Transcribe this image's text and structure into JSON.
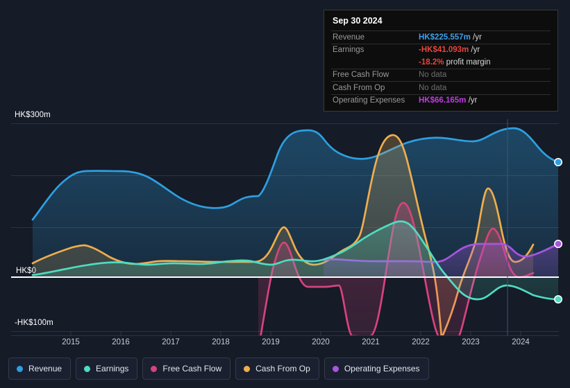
{
  "tooltip": {
    "date": "Sep 30 2024",
    "rows": [
      {
        "key": "Revenue",
        "value": "HK$225.557m",
        "unit": " /yr",
        "color": "#3f9fe8",
        "sub": false
      },
      {
        "key": "Earnings",
        "value": "-HK$41.093m",
        "unit": " /yr",
        "color": "#e8453c",
        "sub": false
      },
      {
        "key": "",
        "value": "-18.2%",
        "unit": " profit margin",
        "color": "#e8453c",
        "sub": true
      },
      {
        "key": "Free Cash Flow",
        "value": "No data",
        "unit": "",
        "color": "#6e6e6e",
        "sub": false
      },
      {
        "key": "Cash From Op",
        "value": "No data",
        "unit": "",
        "color": "#6e6e6e",
        "sub": false
      },
      {
        "key": "Operating Expenses",
        "value": "HK$66.165m",
        "unit": " /yr",
        "color": "#c13ae8",
        "sub": false
      }
    ]
  },
  "legend": [
    {
      "label": "Revenue",
      "color": "#2e9fe0"
    },
    {
      "label": "Earnings",
      "color": "#4fdcc0"
    },
    {
      "label": "Free Cash Flow",
      "color": "#d6437e"
    },
    {
      "label": "Cash From Op",
      "color": "#efae4e"
    },
    {
      "label": "Operating Expenses",
      "color": "#a855e0"
    }
  ],
  "chart_data": {
    "type": "line",
    "title": "",
    "xlabel": "",
    "ylabel": "",
    "currency": "HK$",
    "unit": "m",
    "grid": true,
    "legend_position": "bottom",
    "ylim": [
      -130,
      320
    ],
    "y_ticks": [
      {
        "value": 300,
        "label": "HK$300m"
      },
      {
        "value": 200,
        "label": ""
      },
      {
        "value": 100,
        "label": ""
      },
      {
        "value": 0,
        "label": "HK$0"
      },
      {
        "value": -100,
        "label": "-HK$100m"
      }
    ],
    "x_ticks": [
      "2015",
      "2016",
      "2017",
      "2018",
      "2019",
      "2020",
      "2021",
      "2022",
      "2023",
      "2024"
    ],
    "x_range": [
      "2014-06",
      "2024-09"
    ],
    "series": [
      {
        "name": "Revenue",
        "color": "#2e9fe0",
        "points": [
          {
            "x": "2014-06",
            "y": 83
          },
          {
            "x": "2014-12",
            "y": 128
          },
          {
            "x": "2015-03",
            "y": 152
          },
          {
            "x": "2015-06",
            "y": 153
          },
          {
            "x": "2016-03",
            "y": 152
          },
          {
            "x": "2016-09",
            "y": 143
          },
          {
            "x": "2017-03",
            "y": 132
          },
          {
            "x": "2017-09",
            "y": 126
          },
          {
            "x": "2018-03",
            "y": 122
          },
          {
            "x": "2018-09",
            "y": 125
          },
          {
            "x": "2019-03",
            "y": 178
          },
          {
            "x": "2019-09",
            "y": 248
          },
          {
            "x": "2020-03",
            "y": 234
          },
          {
            "x": "2020-09",
            "y": 219
          },
          {
            "x": "2021-03",
            "y": 212
          },
          {
            "x": "2021-09",
            "y": 229
          },
          {
            "x": "2022-03",
            "y": 238
          },
          {
            "x": "2022-09",
            "y": 233
          },
          {
            "x": "2023-03",
            "y": 231
          },
          {
            "x": "2023-09",
            "y": 254
          },
          {
            "x": "2024-03",
            "y": 243
          },
          {
            "x": "2024-09",
            "y": 225.557
          }
        ]
      },
      {
        "name": "Earnings",
        "color": "#4fdcc0",
        "points": [
          {
            "x": "2014-06",
            "y": 3
          },
          {
            "x": "2015-03",
            "y": 14
          },
          {
            "x": "2016-03",
            "y": 22
          },
          {
            "x": "2016-09",
            "y": 19
          },
          {
            "x": "2017-06",
            "y": 21
          },
          {
            "x": "2018-03",
            "y": 16
          },
          {
            "x": "2018-09",
            "y": 20
          },
          {
            "x": "2019-03",
            "y": 26
          },
          {
            "x": "2019-09",
            "y": 22
          },
          {
            "x": "2020-03",
            "y": 30
          },
          {
            "x": "2020-09",
            "y": 48
          },
          {
            "x": "2021-03",
            "y": 73
          },
          {
            "x": "2021-06",
            "y": 79
          },
          {
            "x": "2021-09",
            "y": 74
          },
          {
            "x": "2022-03",
            "y": 20
          },
          {
            "x": "2022-09",
            "y": -37
          },
          {
            "x": "2023-03",
            "y": -43
          },
          {
            "x": "2023-09",
            "y": -24
          },
          {
            "x": "2024-03",
            "y": -33
          },
          {
            "x": "2024-09",
            "y": -41.093
          }
        ]
      },
      {
        "name": "Free Cash Flow",
        "color": "#d6437e",
        "points": [
          {
            "x": "2018-09",
            "y": -106
          },
          {
            "x": "2019-03",
            "y": 22
          },
          {
            "x": "2019-09",
            "y": -34
          },
          {
            "x": "2020-03",
            "y": -32
          },
          {
            "x": "2020-06",
            "y": -115
          },
          {
            "x": "2021-03",
            "y": 105
          },
          {
            "x": "2021-09",
            "y": -30
          },
          {
            "x": "2022-03",
            "y": -122
          },
          {
            "x": "2022-09",
            "y": -14
          },
          {
            "x": "2023-03",
            "y": 70
          },
          {
            "x": "2023-09",
            "y": -20
          },
          {
            "x": "2024-03",
            "y": -20
          }
        ]
      },
      {
        "name": "Cash From Op",
        "color": "#efae4e",
        "points": [
          {
            "x": "2014-06",
            "y": 20
          },
          {
            "x": "2015-03",
            "y": 46
          },
          {
            "x": "2016-03",
            "y": 27
          },
          {
            "x": "2016-09",
            "y": 22
          },
          {
            "x": "2017-09",
            "y": 24
          },
          {
            "x": "2018-09",
            "y": 22
          },
          {
            "x": "2019-03",
            "y": 73
          },
          {
            "x": "2019-09",
            "y": 18
          },
          {
            "x": "2020-03",
            "y": 38
          },
          {
            "x": "2020-09",
            "y": 205
          },
          {
            "x": "2021-03",
            "y": 213
          },
          {
            "x": "2021-09",
            "y": 40
          },
          {
            "x": "2022-03",
            "y": -88
          },
          {
            "x": "2022-09",
            "y": 12
          },
          {
            "x": "2023-03",
            "y": 128
          },
          {
            "x": "2023-09",
            "y": 22
          },
          {
            "x": "2024-03",
            "y": 47
          }
        ]
      },
      {
        "name": "Operating Expenses",
        "color": "#a855e0",
        "points": [
          {
            "x": "2019-09",
            "y": 26
          },
          {
            "x": "2020-03",
            "y": 24
          },
          {
            "x": "2020-09",
            "y": 25
          },
          {
            "x": "2021-09",
            "y": 26
          },
          {
            "x": "2022-03",
            "y": 22
          },
          {
            "x": "2022-09",
            "y": 46
          },
          {
            "x": "2023-03",
            "y": 49
          },
          {
            "x": "2023-09",
            "y": 32
          },
          {
            "x": "2024-03",
            "y": 41
          },
          {
            "x": "2024-09",
            "y": 66.165
          }
        ]
      }
    ],
    "endpoints": [
      {
        "series": "Revenue",
        "color": "#2e9fe0"
      },
      {
        "series": "Earnings",
        "color": "#4fdcc0"
      },
      {
        "series": "Operating Expenses",
        "color": "#a855e0"
      }
    ]
  }
}
